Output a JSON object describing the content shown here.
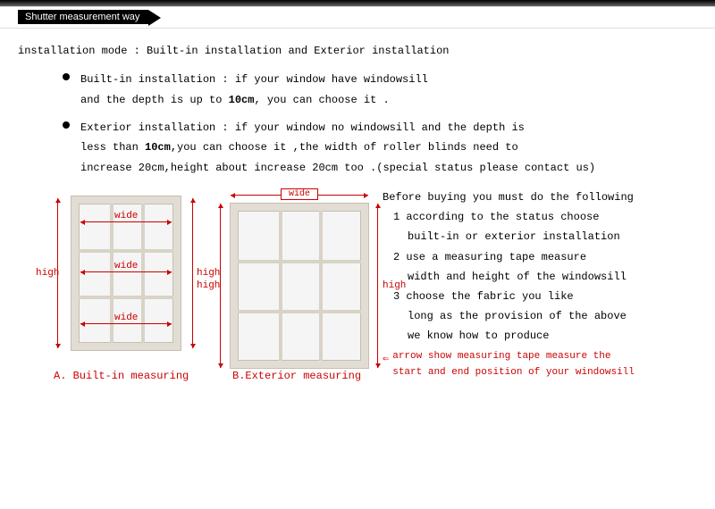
{
  "header": {
    "title": "Shutter measurement way"
  },
  "mode_line": "installation mode : Built-in installation and Exterior installation",
  "bullets": {
    "builtin_l1": "Built-in installation : if your window have windowsill",
    "builtin_l2a": "and the depth is up to ",
    "builtin_l2b": "10cm",
    "builtin_l2c": ", you can choose it .",
    "ext_l1": "Exterior installation : if your window no windowsill and the depth is",
    "ext_l2a": "less than ",
    "ext_l2b": "10cm",
    "ext_l2c": ",you can choose it ,the width of roller blinds need to",
    "ext_l3": "increase 20cm,height about increase 20cm too .(special status please contact us)"
  },
  "labels": {
    "wide": "wide",
    "high": "high"
  },
  "captions": {
    "a": "A. Built-in measuring",
    "b": "B.Exterior measuring"
  },
  "instructions": {
    "intro": "Before buying you must do the following",
    "l1": "1 according to the status choose",
    "l1b": "built-in or exterior installation",
    "l2": "2 use a measuring tape measure",
    "l2b": "width and height of the windowsill",
    "l3": "3 choose the fabric you like",
    "l3b": "long as the provision of the above",
    "l3c": "we know how to produce",
    "arrow_note_l1": "arrow show measuring tape measure the",
    "arrow_note_l2": "start and end position of your windowsill"
  }
}
